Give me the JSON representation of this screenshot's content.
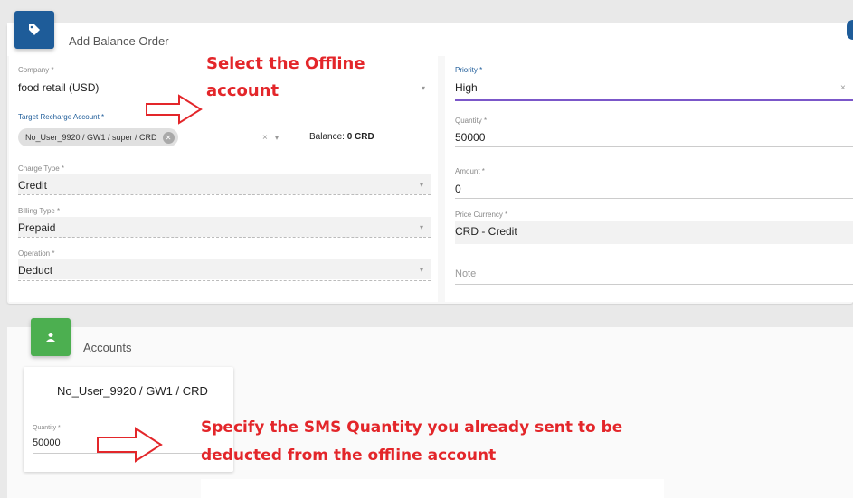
{
  "order_card": {
    "title": "Add Balance Order",
    "icon": "tag-icon",
    "accent": "#1e5c99"
  },
  "left_form": {
    "company": {
      "label": "Company *",
      "value": "food retail (USD)"
    },
    "target_account": {
      "label": "Target Recharge Account *",
      "chip": "No_User_9920 / GW1 / super / CRD",
      "clear": "×",
      "balance_label": "Balance:",
      "balance_value": "0 CRD"
    },
    "charge_type": {
      "label": "Charge Type *",
      "value": "Credit"
    },
    "billing_type": {
      "label": "Billing Type *",
      "value": "Prepaid"
    },
    "operation": {
      "label": "Operation *",
      "value": "Deduct"
    }
  },
  "right_form": {
    "priority": {
      "label": "Priority *",
      "value": "High",
      "clear": "×"
    },
    "quantity": {
      "label": "Quantity *",
      "value": "50000"
    },
    "amount": {
      "label": "Amount *",
      "value": "0"
    },
    "price_currency": {
      "label": "Price Currency *",
      "value": "CRD - Credit"
    },
    "note": {
      "placeholder": "Note"
    }
  },
  "accounts_card": {
    "title": "Accounts",
    "icon": "user-icon",
    "accent": "#4caf50",
    "account": {
      "name": "No_User_9920 / GW1 / CRD",
      "quantity_label": "Quantity *",
      "quantity_value": "50000"
    }
  },
  "annotations": {
    "offline_line1": "Select the Offline",
    "offline_line2": "account",
    "sms_line1": "Specify the SMS Quantity you already sent to be",
    "sms_line2": "deducted from the offline account",
    "color": "#e3262a"
  }
}
